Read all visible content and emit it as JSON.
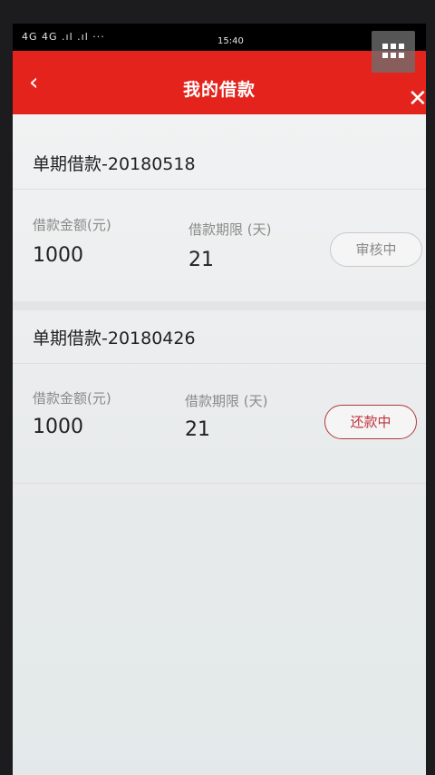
{
  "statusbar": {
    "network": "4G 4G .ıl .ıl ···",
    "time": "15:40"
  },
  "navbar": {
    "back_icon": "‹",
    "title": "我的借款",
    "close_icon": "✕"
  },
  "loans": [
    {
      "title": "单期借款-20180518",
      "amount_label": "借款金额(元)",
      "amount": "1000",
      "term_label": "借款期限 (天)",
      "term": "21",
      "status": "审核中"
    },
    {
      "title": "单期借款-20180426",
      "amount_label": "借款金额(元)",
      "amount": "1000",
      "term_label": "借款期限 (天)",
      "term": "21",
      "status": "还款中"
    }
  ],
  "colors": {
    "brand_red": "#e4241c",
    "repay_border": "#b33a3f"
  }
}
